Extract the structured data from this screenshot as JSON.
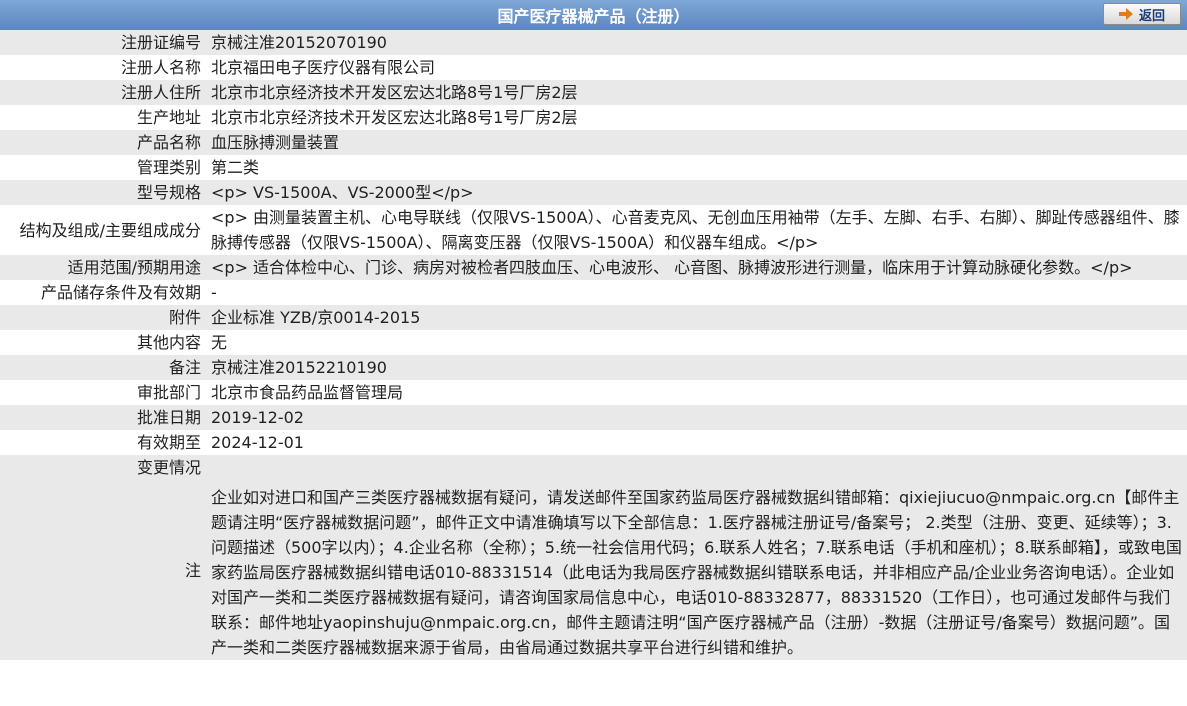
{
  "header": {
    "title": "国产医疗器械产品（注册）",
    "back_label": "返回"
  },
  "rows": [
    {
      "label": "注册证编号",
      "value": "京械注准20152070190"
    },
    {
      "label": "注册人名称",
      "value": "北京福田电子医疗仪器有限公司"
    },
    {
      "label": "注册人住所",
      "value": "北京市北京经济技术开发区宏达北路8号1号厂房2层"
    },
    {
      "label": "生产地址",
      "value": "北京市北京经济技术开发区宏达北路8号1号厂房2层"
    },
    {
      "label": "产品名称",
      "value": "血压脉搏测量装置"
    },
    {
      "label": "管理类别",
      "value": "第二类"
    },
    {
      "label": "型号规格",
      "value": "<p> VS-1500A、VS-2000型</p>"
    },
    {
      "label": "结构及组成/主要组成成分",
      "value": "<p> 由测量装置主机、心电导联线（仅限VS-1500A）、心音麦克风、无创血压用袖带（左手、左脚、右手、右脚）、脚趾传感器组件、膝脉搏传感器（仅限VS-1500A）、隔离变压器（仅限VS-1500A）和仪器车组成。</p>"
    },
    {
      "label": "适用范围/预期用途",
      "value": "<p> 适合体检中心、门诊、病房对被检者四肢血压、心电波形、 心音图、脉搏波形进行测量，临床用于计算动脉硬化参数。</p>"
    },
    {
      "label": "产品储存条件及有效期",
      "value": "-"
    },
    {
      "label": "附件",
      "value": "企业标准 YZB/京0014-2015"
    },
    {
      "label": "其他内容",
      "value": "无"
    },
    {
      "label": "备注",
      "value": "京械注准20152210190"
    },
    {
      "label": "审批部门",
      "value": "北京市食品药品监督管理局"
    },
    {
      "label": "批准日期",
      "value": "2019-12-02"
    },
    {
      "label": "有效期至",
      "value": "2024-12-01"
    },
    {
      "label": "变更情况",
      "value": ""
    }
  ],
  "note": {
    "label": "注",
    "text": "企业如对进口和国产三类医疗器械数据有疑问，请发送邮件至国家药监局医疗器械数据纠错邮箱：qixiejiucuo@nmpaic.org.cn【邮件主题请注明“医疗器械数据问题”，邮件正文中请准确填写以下全部信息：1.医疗器械注册证号/备案号； 2.类型（注册、变更、延续等）；3.问题描述（500字以内）；4.企业名称（全称）；5.统一社会信用代码；6.联系人姓名；7.联系电话（手机和座机）；8.联系邮箱】，或致电国家药监局医疗器械数据纠错电话010-88331514（此电话为我局医疗器械数据纠错联系电话，并非相应产品/企业业务咨询电话）。企业如对国产一类和二类医疗器械数据有疑问，请咨询国家局信息中心，电话010-88332877，88331520（工作日），也可通过发邮件与我们联系：邮件地址yaopinshuju@nmpaic.org.cn，邮件主题请注明“国产医疗器械产品（注册）-数据（注册证号/备案号）数据问题”。国产一类和二类医疗器械数据来源于省局，由省局通过数据共享平台进行纠错和维护。"
  },
  "colors": {
    "header_bg": "#6b93c9",
    "row_alt_bg": "#e9e9e9",
    "back_arrow": "#e07a1a"
  }
}
